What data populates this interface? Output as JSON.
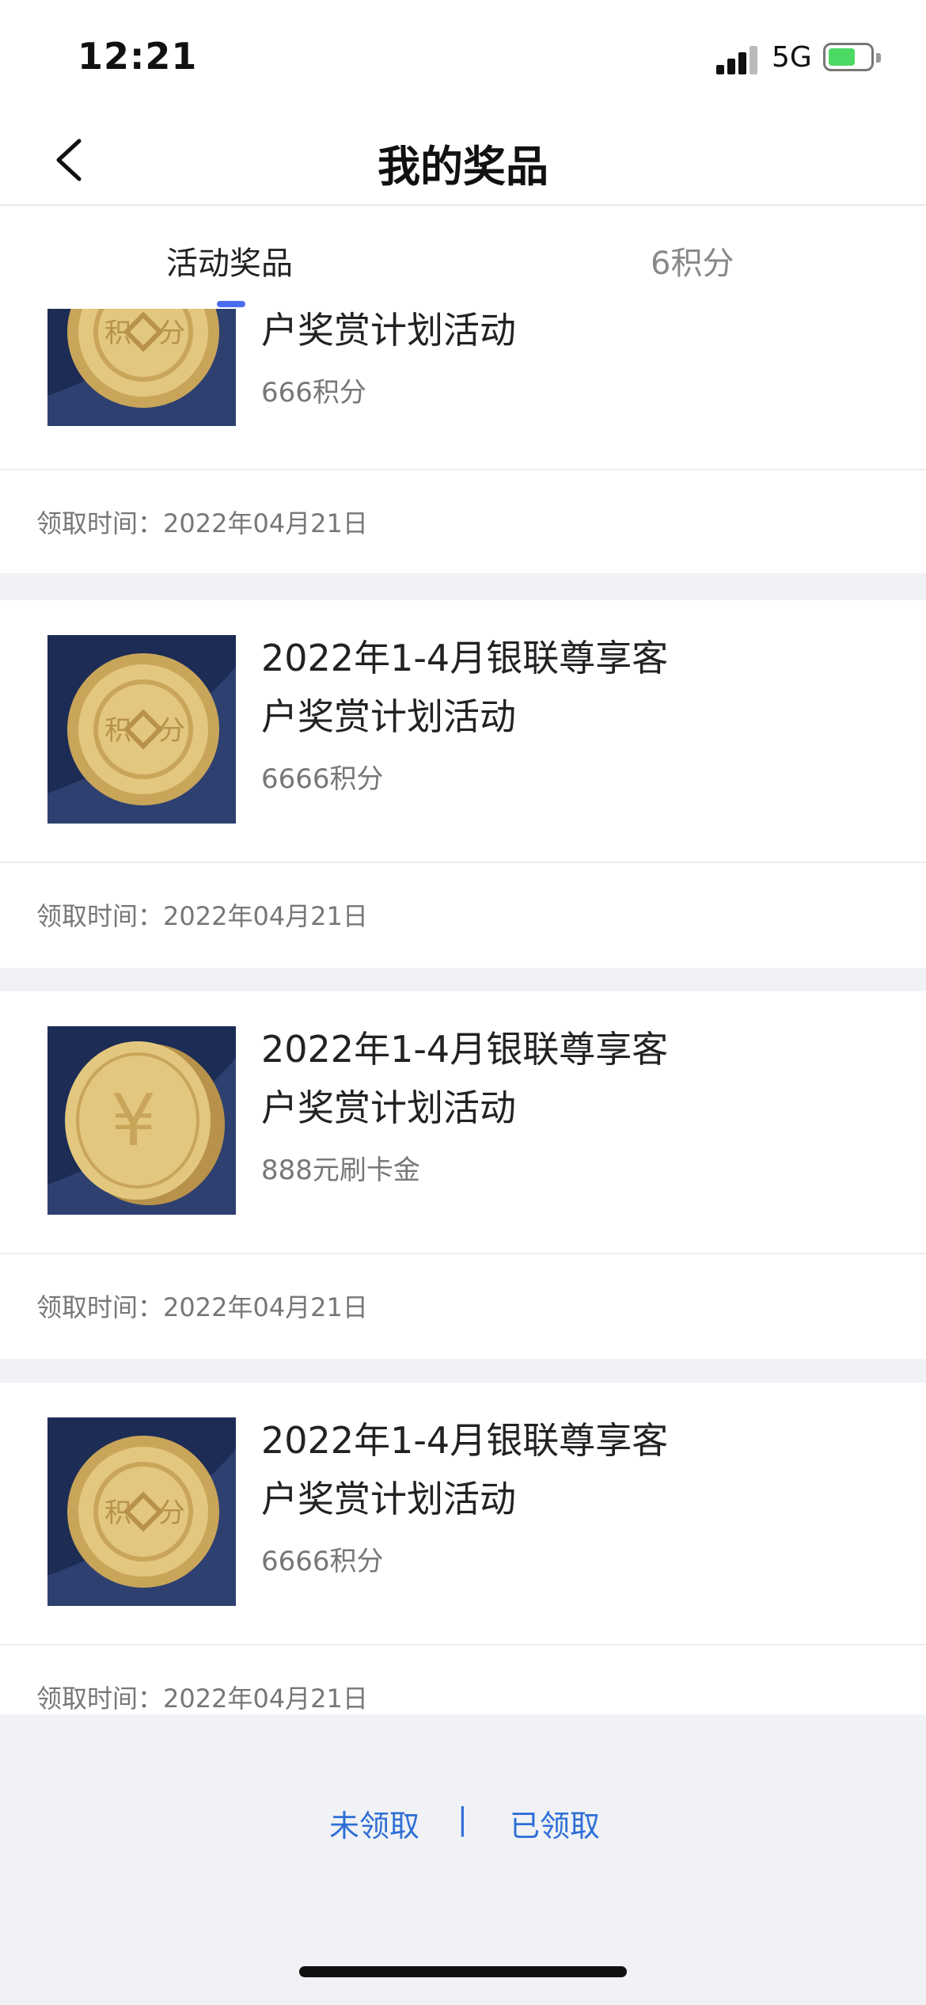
{
  "status_bar": {
    "time": "12:21",
    "network": "5G",
    "battery_level": 0.65,
    "battery_color": "#4cd964"
  },
  "nav": {
    "back_icon": "chevron-left-icon",
    "title": "我的奖品"
  },
  "tabs": [
    {
      "label": "活动奖品",
      "active": true
    },
    {
      "label": "6积分",
      "active": false
    }
  ],
  "accent_color": "#4a6ef0",
  "prizes": [
    {
      "name_line1": "",
      "name_line2": "户奖赏计划活动",
      "amount": "666积分",
      "icon": "points-coin-icon",
      "claim_label": "领取时间：",
      "claim_date": "2022年04月21日"
    },
    {
      "name_line1": "2022年1-4月银联尊享客",
      "name_line2": "户奖赏计划活动",
      "amount": "6666积分",
      "icon": "points-coin-icon",
      "claim_label": "领取时间：",
      "claim_date": "2022年04月21日"
    },
    {
      "name_line1": "2022年1-4月银联尊享客",
      "name_line2": "户奖赏计划活动",
      "amount": "888元刷卡金",
      "icon": "yuan-coin-icon",
      "claim_label": "领取时间：",
      "claim_date": "2022年04月21日"
    },
    {
      "name_line1": "2022年1-4月银联尊享客",
      "name_line2": "户奖赏计划活动",
      "amount": "6666积分",
      "icon": "points-coin-icon",
      "claim_label": "领取时间：",
      "claim_date": "2022年04月21日"
    }
  ],
  "coin_glyphs": {
    "points_left": "积",
    "points_right": "分",
    "yuan": "¥"
  },
  "footer": {
    "unclaimed": "未领取",
    "separator": "|",
    "claimed": "已领取",
    "link_color": "#2f6fd6"
  }
}
